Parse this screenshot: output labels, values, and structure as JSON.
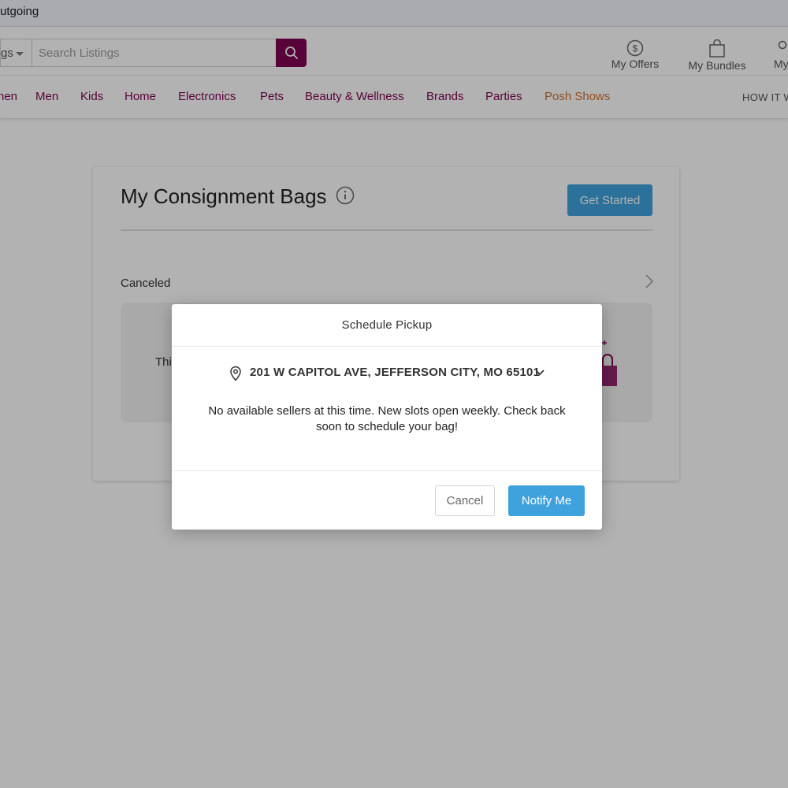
{
  "browser": {
    "bookmark_label": "utgoing"
  },
  "header": {
    "search_category": "gs",
    "search_placeholder": "Search Listings",
    "links": [
      {
        "label": "My Offers",
        "icon": "dollar-circle-icon"
      },
      {
        "label": "My Bundles",
        "icon": "shopping-bag-icon"
      },
      {
        "label": "My",
        "icon": "user-icon"
      }
    ]
  },
  "nav": {
    "items": [
      "nen",
      "Men",
      "Kids",
      "Home",
      "Electronics",
      "Pets",
      "Beauty & Wellness",
      "Brands",
      "Parties",
      "Posh Shows"
    ],
    "right_link": "HOW IT W"
  },
  "card": {
    "title": "My Consignment Bags",
    "get_started_label": "Get Started",
    "status": "Canceled",
    "bag_text": "Thi"
  },
  "modal": {
    "title": "Schedule Pickup",
    "address": "201 W CAPITOL AVE, JEFFERSON CITY, MO 65101",
    "message": "No available sellers at this time. New slots open weekly. Check back soon to schedule your bag!",
    "cancel_label": "Cancel",
    "notify_label": "Notify Me"
  },
  "colors": {
    "brand": "#7f0353",
    "accent_blue": "#3fa2dc",
    "posh_shows": "#d0702c"
  }
}
